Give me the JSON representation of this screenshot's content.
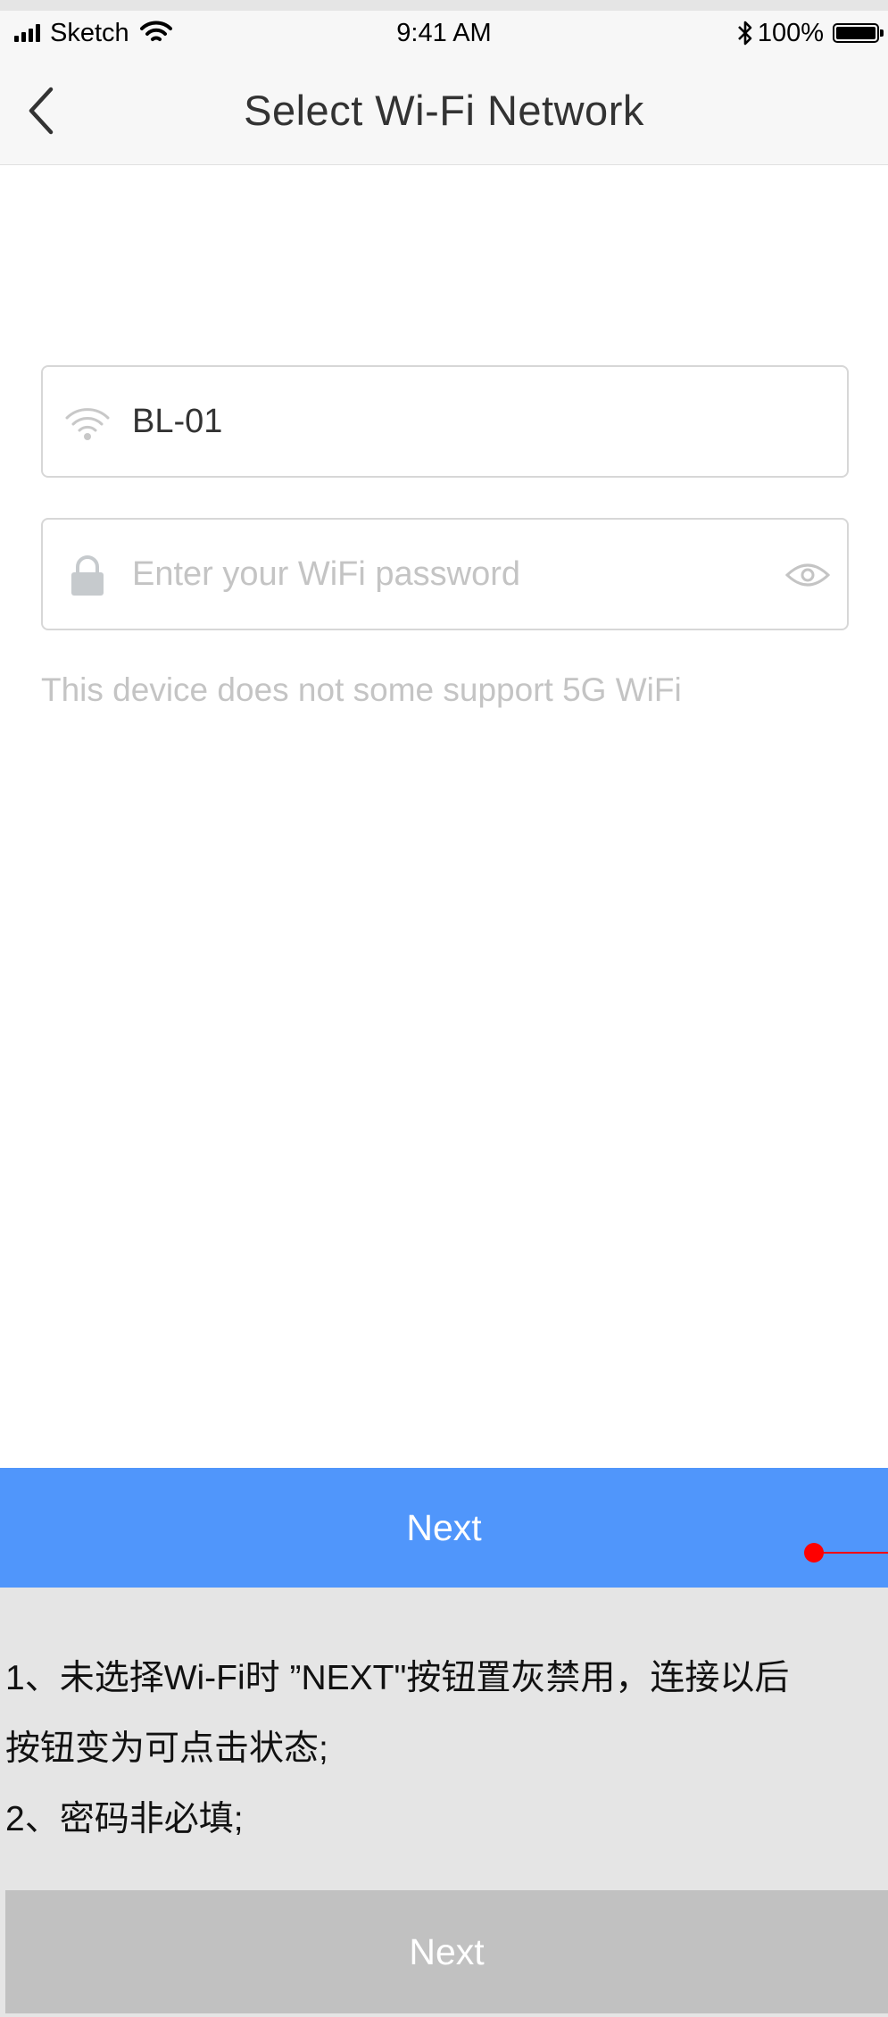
{
  "status_bar": {
    "carrier": "Sketch",
    "time": "9:41 AM",
    "battery": "100%",
    "icons": [
      "signal-icon",
      "wifi-icon",
      "bluetooth-icon",
      "battery-icon"
    ]
  },
  "nav": {
    "title": "Select Wi-Fi Network",
    "back_icon": "chevron-left-icon"
  },
  "form": {
    "network": {
      "icon": "wifi-icon",
      "value": "BL-01"
    },
    "password": {
      "icon": "lock-icon",
      "value": "",
      "placeholder": "Enter your WiFi password",
      "toggle_icon": "eye-icon"
    },
    "hint": "This device does not some support 5G WiFi"
  },
  "primary_button": {
    "label": "Next",
    "color": "#5096fb"
  },
  "annotation": {
    "pointer_color": "#ff0000",
    "notes": [
      "1、未选择Wi-Fi时 ”NEXT\"按钮置灰禁用，连接以后",
      "按钮变为可点击状态;",
      "2、密码非必填;"
    ],
    "disabled_button": {
      "label": "Next",
      "color": "#c1c1c1"
    }
  }
}
